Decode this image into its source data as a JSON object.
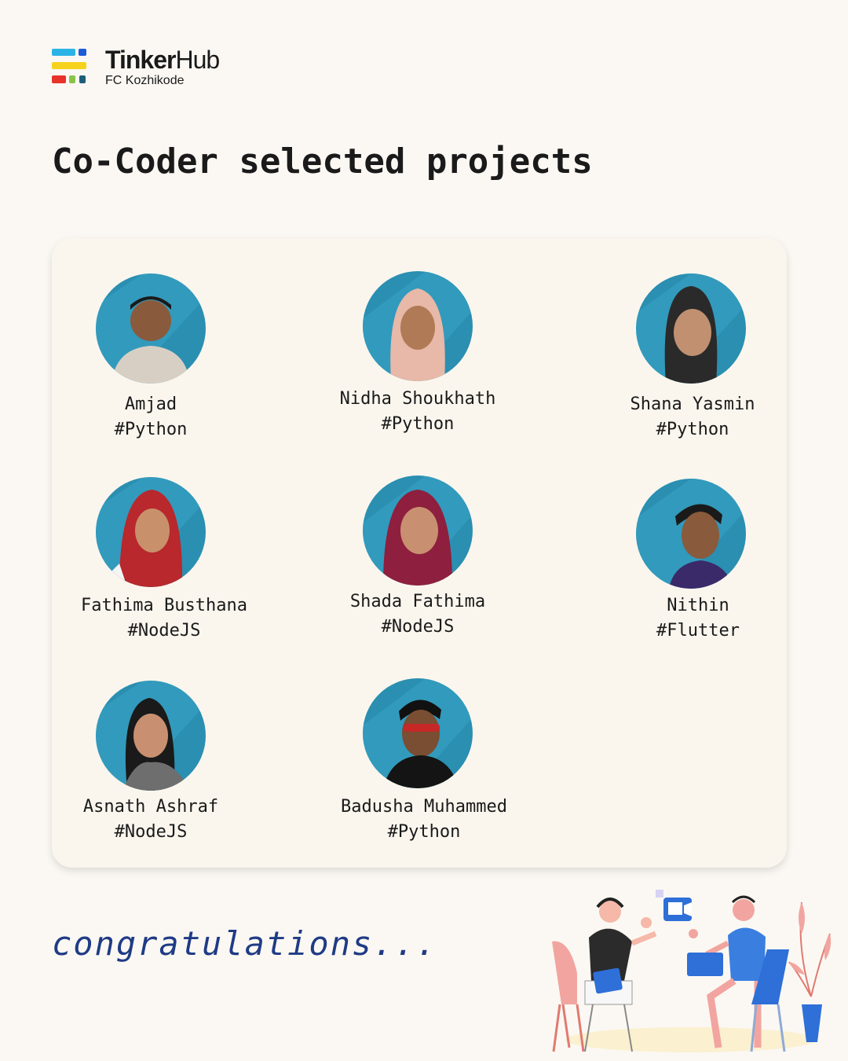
{
  "brand": {
    "name_bold": "Tinker",
    "name_regular": "Hub",
    "subtitle": "FC Kozhikode"
  },
  "page_title": "Co-Coder selected projects",
  "members": [
    {
      "name": "Amjad",
      "tag": "#Python"
    },
    {
      "name": "Nidha Shoukhath",
      "tag": "#Python"
    },
    {
      "name": "Shana Yasmin",
      "tag": "#Python"
    },
    {
      "name": "Fathima Busthana",
      "tag": "#NodeJS"
    },
    {
      "name": "Shada Fathima",
      "tag": "#NodeJS"
    },
    {
      "name": "Nithin",
      "tag": "#Flutter"
    },
    {
      "name": "Asnath Ashraf",
      "tag": "#NodeJS"
    },
    {
      "name": "Badusha Muhammed",
      "tag": "#Python"
    }
  ],
  "footer": {
    "message": "congratulations..."
  },
  "colors": {
    "background": "#fbf8f3",
    "card": "#faf6ee",
    "photo_bg": "#2a8fb1",
    "accent_blue": "#1f3b85"
  },
  "icons": [
    "tinkerhub-logo-icon",
    "video-call-icon",
    "chat-bubble-icon",
    "headset-icon",
    "laptop-icon",
    "plant-icon"
  ]
}
